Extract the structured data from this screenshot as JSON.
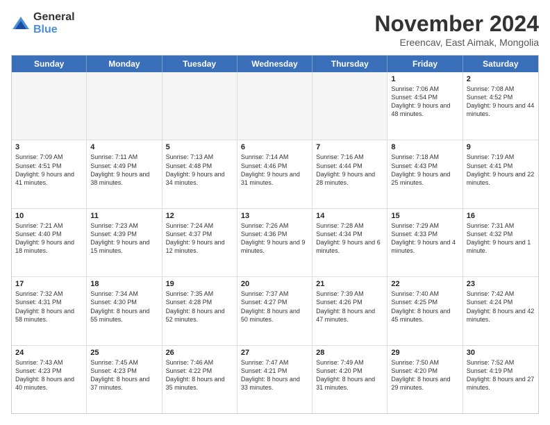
{
  "header": {
    "logo": {
      "general": "General",
      "blue": "Blue"
    },
    "title": "November 2024",
    "subtitle": "Ereencav, East Aimak, Mongolia"
  },
  "days_of_week": [
    "Sunday",
    "Monday",
    "Tuesday",
    "Wednesday",
    "Thursday",
    "Friday",
    "Saturday"
  ],
  "rows": [
    [
      {
        "day": "",
        "info": ""
      },
      {
        "day": "",
        "info": ""
      },
      {
        "day": "",
        "info": ""
      },
      {
        "day": "",
        "info": ""
      },
      {
        "day": "",
        "info": ""
      },
      {
        "day": "1",
        "info": "Sunrise: 7:06 AM\nSunset: 4:54 PM\nDaylight: 9 hours and 48 minutes."
      },
      {
        "day": "2",
        "info": "Sunrise: 7:08 AM\nSunset: 4:52 PM\nDaylight: 9 hours and 44 minutes."
      }
    ],
    [
      {
        "day": "3",
        "info": "Sunrise: 7:09 AM\nSunset: 4:51 PM\nDaylight: 9 hours and 41 minutes."
      },
      {
        "day": "4",
        "info": "Sunrise: 7:11 AM\nSunset: 4:49 PM\nDaylight: 9 hours and 38 minutes."
      },
      {
        "day": "5",
        "info": "Sunrise: 7:13 AM\nSunset: 4:48 PM\nDaylight: 9 hours and 34 minutes."
      },
      {
        "day": "6",
        "info": "Sunrise: 7:14 AM\nSunset: 4:46 PM\nDaylight: 9 hours and 31 minutes."
      },
      {
        "day": "7",
        "info": "Sunrise: 7:16 AM\nSunset: 4:44 PM\nDaylight: 9 hours and 28 minutes."
      },
      {
        "day": "8",
        "info": "Sunrise: 7:18 AM\nSunset: 4:43 PM\nDaylight: 9 hours and 25 minutes."
      },
      {
        "day": "9",
        "info": "Sunrise: 7:19 AM\nSunset: 4:41 PM\nDaylight: 9 hours and 22 minutes."
      }
    ],
    [
      {
        "day": "10",
        "info": "Sunrise: 7:21 AM\nSunset: 4:40 PM\nDaylight: 9 hours and 18 minutes."
      },
      {
        "day": "11",
        "info": "Sunrise: 7:23 AM\nSunset: 4:39 PM\nDaylight: 9 hours and 15 minutes."
      },
      {
        "day": "12",
        "info": "Sunrise: 7:24 AM\nSunset: 4:37 PM\nDaylight: 9 hours and 12 minutes."
      },
      {
        "day": "13",
        "info": "Sunrise: 7:26 AM\nSunset: 4:36 PM\nDaylight: 9 hours and 9 minutes."
      },
      {
        "day": "14",
        "info": "Sunrise: 7:28 AM\nSunset: 4:34 PM\nDaylight: 9 hours and 6 minutes."
      },
      {
        "day": "15",
        "info": "Sunrise: 7:29 AM\nSunset: 4:33 PM\nDaylight: 9 hours and 4 minutes."
      },
      {
        "day": "16",
        "info": "Sunrise: 7:31 AM\nSunset: 4:32 PM\nDaylight: 9 hours and 1 minute."
      }
    ],
    [
      {
        "day": "17",
        "info": "Sunrise: 7:32 AM\nSunset: 4:31 PM\nDaylight: 8 hours and 58 minutes."
      },
      {
        "day": "18",
        "info": "Sunrise: 7:34 AM\nSunset: 4:30 PM\nDaylight: 8 hours and 55 minutes."
      },
      {
        "day": "19",
        "info": "Sunrise: 7:35 AM\nSunset: 4:28 PM\nDaylight: 8 hours and 52 minutes."
      },
      {
        "day": "20",
        "info": "Sunrise: 7:37 AM\nSunset: 4:27 PM\nDaylight: 8 hours and 50 minutes."
      },
      {
        "day": "21",
        "info": "Sunrise: 7:39 AM\nSunset: 4:26 PM\nDaylight: 8 hours and 47 minutes."
      },
      {
        "day": "22",
        "info": "Sunrise: 7:40 AM\nSunset: 4:25 PM\nDaylight: 8 hours and 45 minutes."
      },
      {
        "day": "23",
        "info": "Sunrise: 7:42 AM\nSunset: 4:24 PM\nDaylight: 8 hours and 42 minutes."
      }
    ],
    [
      {
        "day": "24",
        "info": "Sunrise: 7:43 AM\nSunset: 4:23 PM\nDaylight: 8 hours and 40 minutes."
      },
      {
        "day": "25",
        "info": "Sunrise: 7:45 AM\nSunset: 4:23 PM\nDaylight: 8 hours and 37 minutes."
      },
      {
        "day": "26",
        "info": "Sunrise: 7:46 AM\nSunset: 4:22 PM\nDaylight: 8 hours and 35 minutes."
      },
      {
        "day": "27",
        "info": "Sunrise: 7:47 AM\nSunset: 4:21 PM\nDaylight: 8 hours and 33 minutes."
      },
      {
        "day": "28",
        "info": "Sunrise: 7:49 AM\nSunset: 4:20 PM\nDaylight: 8 hours and 31 minutes."
      },
      {
        "day": "29",
        "info": "Sunrise: 7:50 AM\nSunset: 4:20 PM\nDaylight: 8 hours and 29 minutes."
      },
      {
        "day": "30",
        "info": "Sunrise: 7:52 AM\nSunset: 4:19 PM\nDaylight: 8 hours and 27 minutes."
      }
    ]
  ]
}
